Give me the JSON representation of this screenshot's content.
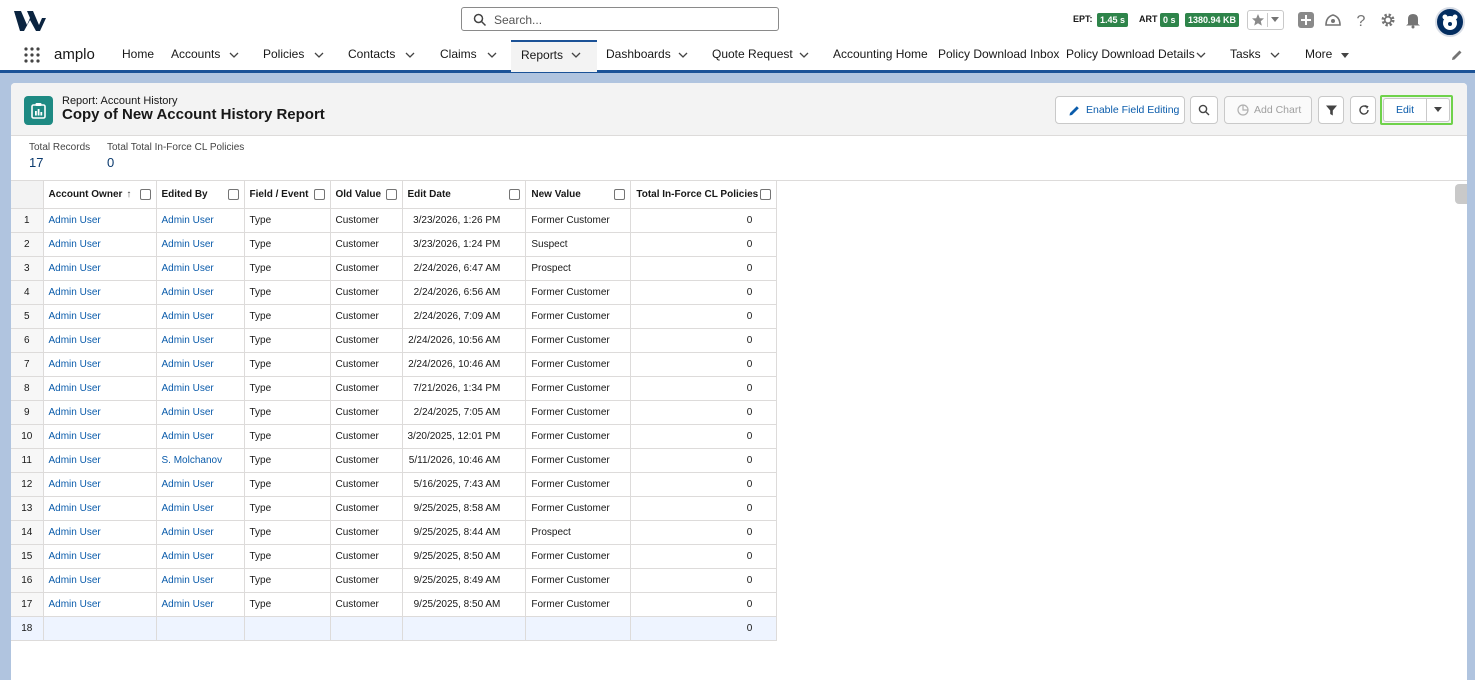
{
  "header": {
    "search_placeholder": "Search...",
    "metrics": [
      {
        "label": "EPT:",
        "value": "1.45 s"
      },
      {
        "label": "ART",
        "value": "0 s"
      },
      {
        "value": "1380.94 KB"
      }
    ],
    "icons": [
      "logo-icon",
      "search-icon",
      "favorites-star-icon",
      "favorites-dropdown-icon",
      "add-icon",
      "trailhead-icon",
      "help-icon",
      "setup-gear-icon",
      "notifications-bell-icon",
      "user-avatar"
    ]
  },
  "nav": {
    "app_name": "amplo",
    "items": [
      {
        "label": "Home",
        "has_menu": false
      },
      {
        "label": "Accounts",
        "has_menu": true
      },
      {
        "label": "Policies",
        "has_menu": true
      },
      {
        "label": "Contacts",
        "has_menu": true
      },
      {
        "label": "Claims",
        "has_menu": true
      },
      {
        "label": "Reports",
        "has_menu": true,
        "active": true
      },
      {
        "label": "Dashboards",
        "has_menu": true
      },
      {
        "label": "Quote Request",
        "has_menu": true
      },
      {
        "label": "Accounting Home",
        "has_menu": false
      },
      {
        "label": "Policy Download Inbox",
        "has_menu": false
      },
      {
        "label": "Policy Download Details",
        "has_menu": true
      },
      {
        "label": "Tasks",
        "has_menu": true
      },
      {
        "label": "More",
        "has_menu": true
      }
    ]
  },
  "report": {
    "type_label": "Report: Account History",
    "title": "Copy of New Account History Report",
    "buttons": {
      "enable_field_editing": "Enable Field Editing",
      "add_chart": "Add Chart",
      "edit": "Edit"
    },
    "summary": [
      {
        "label": "Total Records",
        "value": "17"
      },
      {
        "label": "Total Total In-Force CL Policies",
        "value": "0"
      }
    ]
  },
  "table": {
    "columns": [
      "Account Owner",
      "Edited By",
      "Field / Event",
      "Old Value",
      "Edit Date",
      "New Value",
      "Total In-Force CL Policies"
    ],
    "sort_indicator": "↑",
    "rows": [
      {
        "n": "1",
        "owner": "Admin User",
        "editor": "Admin User",
        "field": "Type",
        "old": "Customer",
        "date": "3/23/2026, 1:26 PM",
        "new": "Former Customer",
        "total": "0"
      },
      {
        "n": "2",
        "owner": "Admin User",
        "editor": "Admin User",
        "field": "Type",
        "old": "Customer",
        "date": "3/23/2026, 1:24 PM",
        "new": "Suspect",
        "total": "0"
      },
      {
        "n": "3",
        "owner": "Admin User",
        "editor": "Admin User",
        "field": "Type",
        "old": "Customer",
        "date": "2/24/2026, 6:47 AM",
        "new": "Prospect",
        "total": "0"
      },
      {
        "n": "4",
        "owner": "Admin User",
        "editor": "Admin User",
        "field": "Type",
        "old": "Customer",
        "date": "2/24/2026, 6:56 AM",
        "new": "Former Customer",
        "total": "0"
      },
      {
        "n": "5",
        "owner": "Admin User",
        "editor": "Admin User",
        "field": "Type",
        "old": "Customer",
        "date": "2/24/2026, 7:09 AM",
        "new": "Former Customer",
        "total": "0"
      },
      {
        "n": "6",
        "owner": "Admin User",
        "editor": "Admin User",
        "field": "Type",
        "old": "Customer",
        "date": "2/24/2026, 10:56 AM",
        "new": "Former Customer",
        "total": "0"
      },
      {
        "n": "7",
        "owner": "Admin User",
        "editor": "Admin User",
        "field": "Type",
        "old": "Customer",
        "date": "2/24/2026, 10:46 AM",
        "new": "Former Customer",
        "total": "0"
      },
      {
        "n": "8",
        "owner": "Admin User",
        "editor": "Admin User",
        "field": "Type",
        "old": "Customer",
        "date": "7/21/2026, 1:34 PM",
        "new": "Former Customer",
        "total": "0"
      },
      {
        "n": "9",
        "owner": "Admin User",
        "editor": "Admin User",
        "field": "Type",
        "old": "Customer",
        "date": "2/24/2025, 7:05 AM",
        "new": "Former Customer",
        "total": "0"
      },
      {
        "n": "10",
        "owner": "Admin User",
        "editor": "Admin User",
        "field": "Type",
        "old": "Customer",
        "date": "3/20/2025, 12:01 PM",
        "new": "Former Customer",
        "total": "0"
      },
      {
        "n": "11",
        "owner": "Admin User",
        "editor": "S. Molchanov",
        "field": "Type",
        "old": "Customer",
        "date": "5/11/2026, 10:46 AM",
        "new": "Former Customer",
        "total": "0"
      },
      {
        "n": "12",
        "owner": "Admin User",
        "editor": "Admin User",
        "field": "Type",
        "old": "Customer",
        "date": "5/16/2025, 7:43 AM",
        "new": "Former Customer",
        "total": "0"
      },
      {
        "n": "13",
        "owner": "Admin User",
        "editor": "Admin User",
        "field": "Type",
        "old": "Customer",
        "date": "9/25/2025, 8:58 AM",
        "new": "Former Customer",
        "total": "0"
      },
      {
        "n": "14",
        "owner": "Admin User",
        "editor": "Admin User",
        "field": "Type",
        "old": "Customer",
        "date": "9/25/2025, 8:44 AM",
        "new": "Prospect",
        "total": "0"
      },
      {
        "n": "15",
        "owner": "Admin User",
        "editor": "Admin User",
        "field": "Type",
        "old": "Customer",
        "date": "9/25/2025, 8:50 AM",
        "new": "Former Customer",
        "total": "0"
      },
      {
        "n": "16",
        "owner": "Admin User",
        "editor": "Admin User",
        "field": "Type",
        "old": "Customer",
        "date": "9/25/2025, 8:49 AM",
        "new": "Former Customer",
        "total": "0"
      },
      {
        "n": "17",
        "owner": "Admin User",
        "editor": "Admin User",
        "field": "Type",
        "old": "Customer",
        "date": "9/25/2025, 8:50 AM",
        "new": "Former Customer",
        "total": "0"
      }
    ],
    "summary_row": {
      "n": "18",
      "total": "0"
    }
  },
  "colors": {
    "brand_blue": "#1b5297",
    "link": "#0b5cab",
    "badge_green": "#2e844a",
    "report_icon": "#1e8a83",
    "highlight": "#6fd24b",
    "page_bg": "#b0c4df"
  }
}
